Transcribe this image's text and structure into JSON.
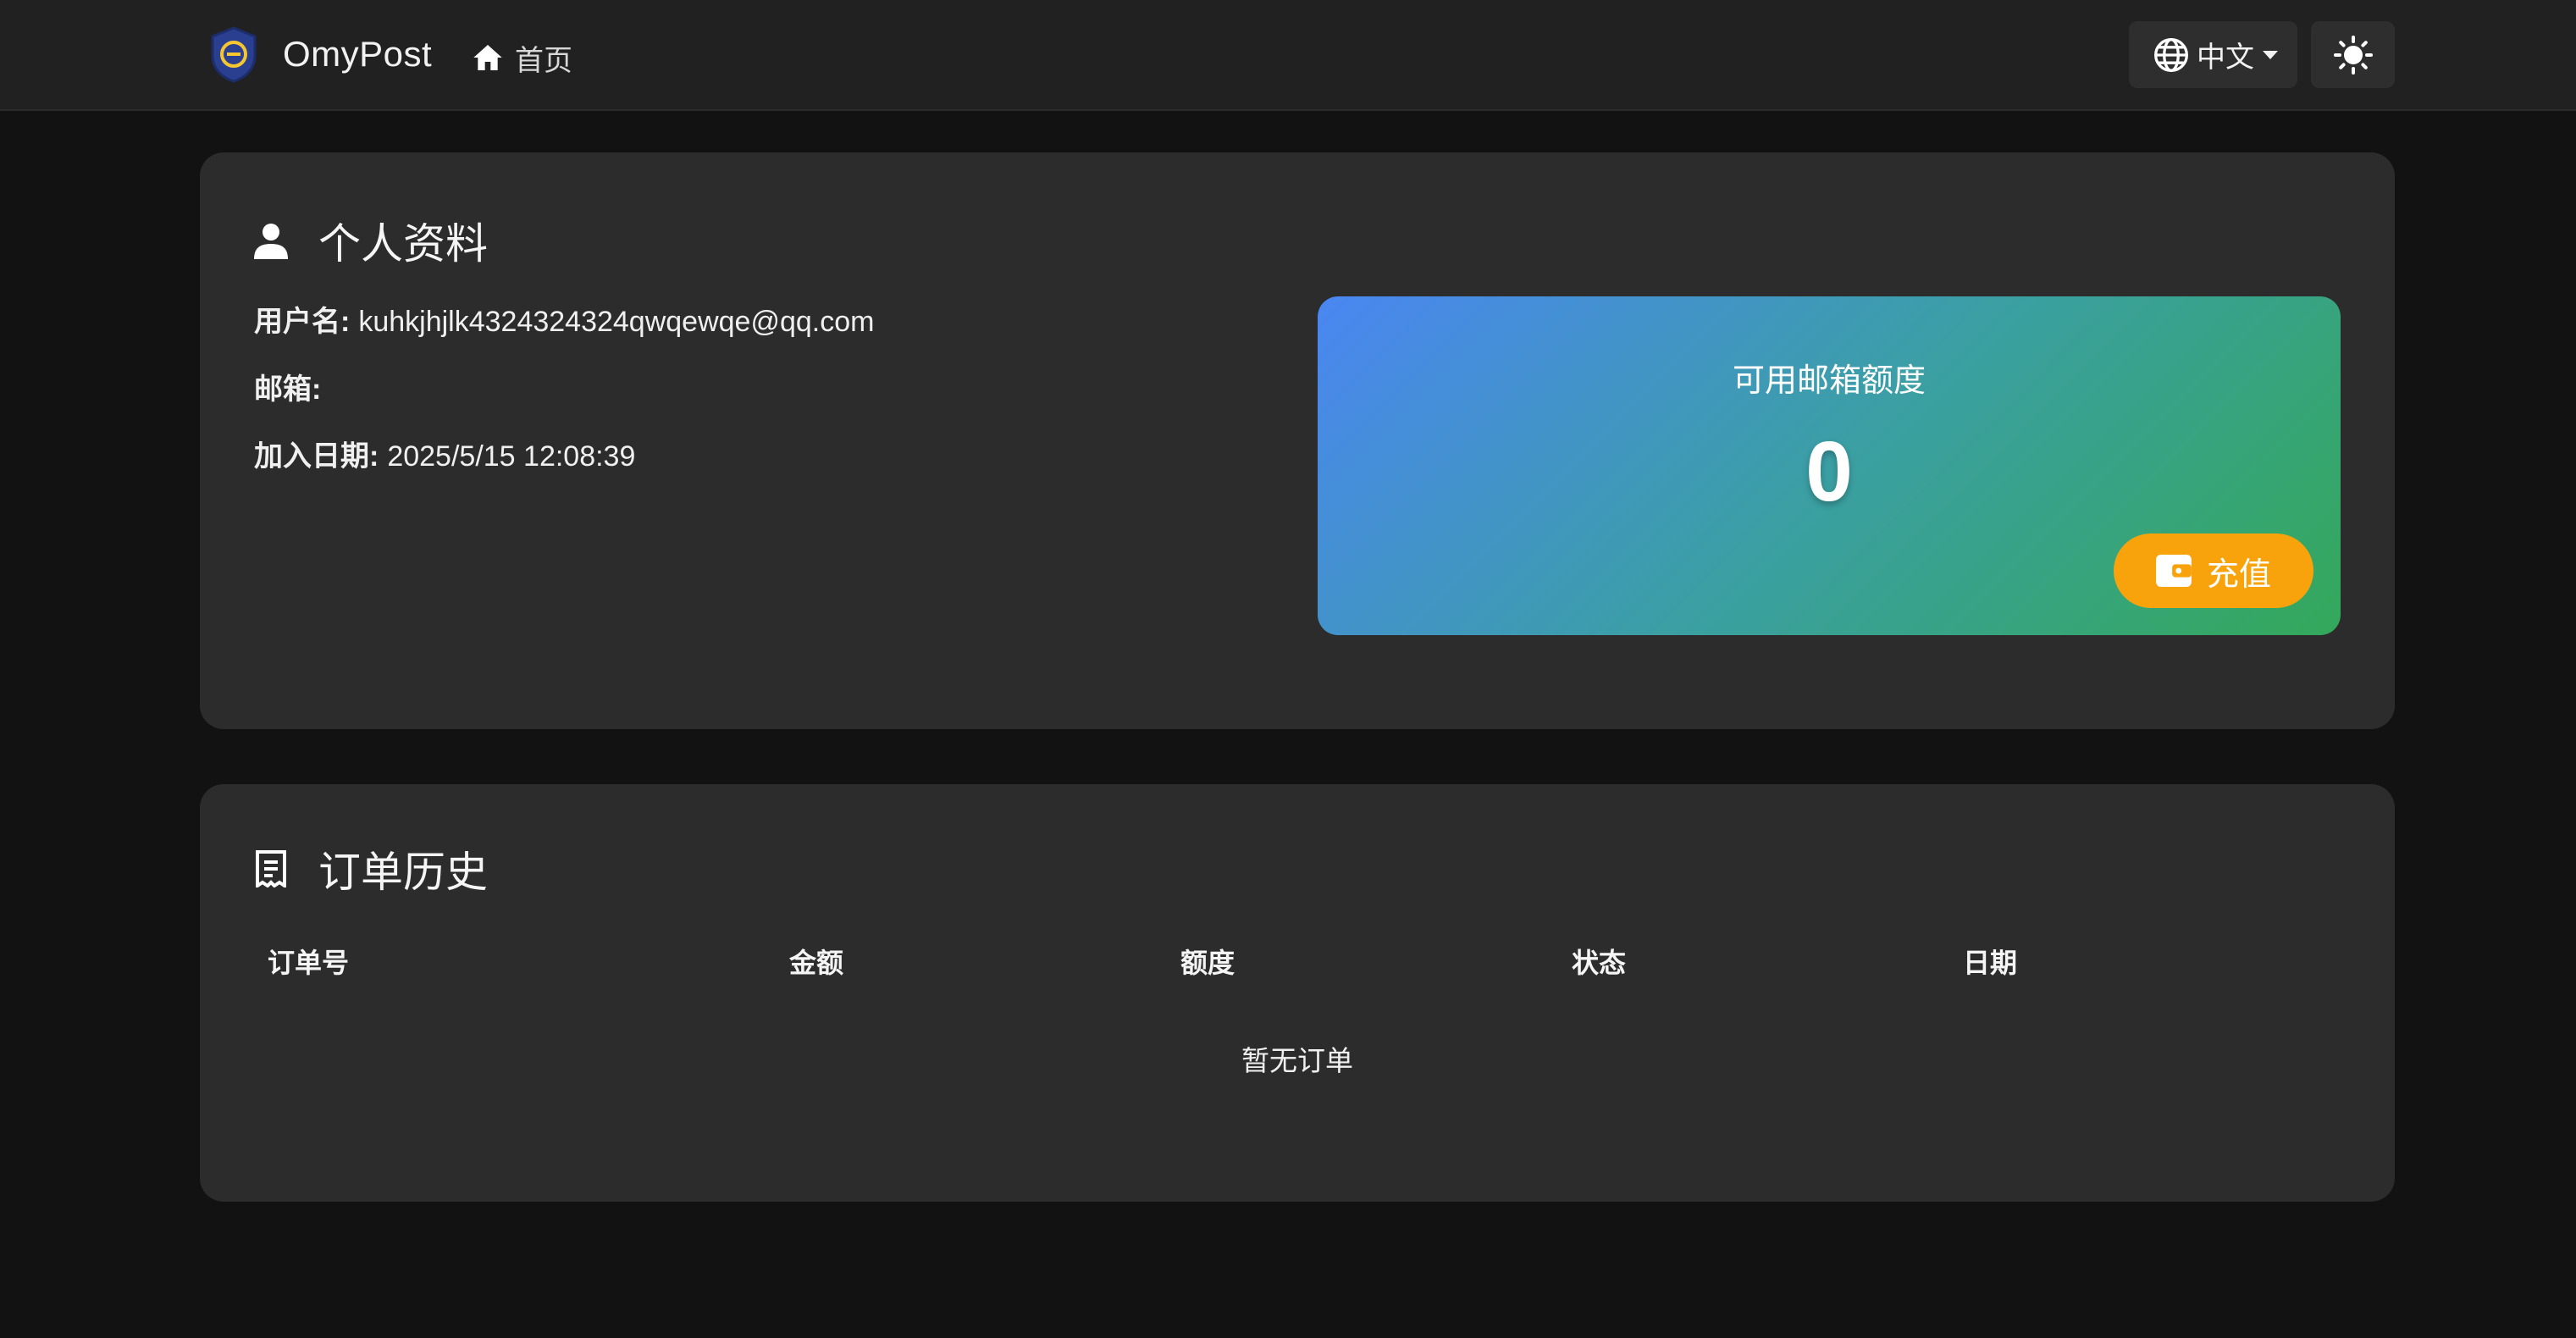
{
  "nav": {
    "brand": "OmyPost",
    "home": "首页",
    "language": "中文"
  },
  "profile": {
    "title": "个人资料",
    "username_label": "用户名:",
    "username": "kuhkjhjlk4324324324qwqewqe@qq.com",
    "email_label": "邮箱:",
    "email": "",
    "joined_label": "加入日期:",
    "joined": "2025/5/15 12:08:39",
    "quota": {
      "label": "可用邮箱额度",
      "value": "0",
      "recharge": "充值"
    }
  },
  "orders": {
    "title": "订单历史",
    "columns": [
      "订单号",
      "金额",
      "额度",
      "状态",
      "日期"
    ],
    "empty": "暂无订单"
  },
  "colors": {
    "accent_orange": "#f9a30c",
    "gradient_start": "#4a86f2",
    "gradient_end": "#34a85a"
  }
}
